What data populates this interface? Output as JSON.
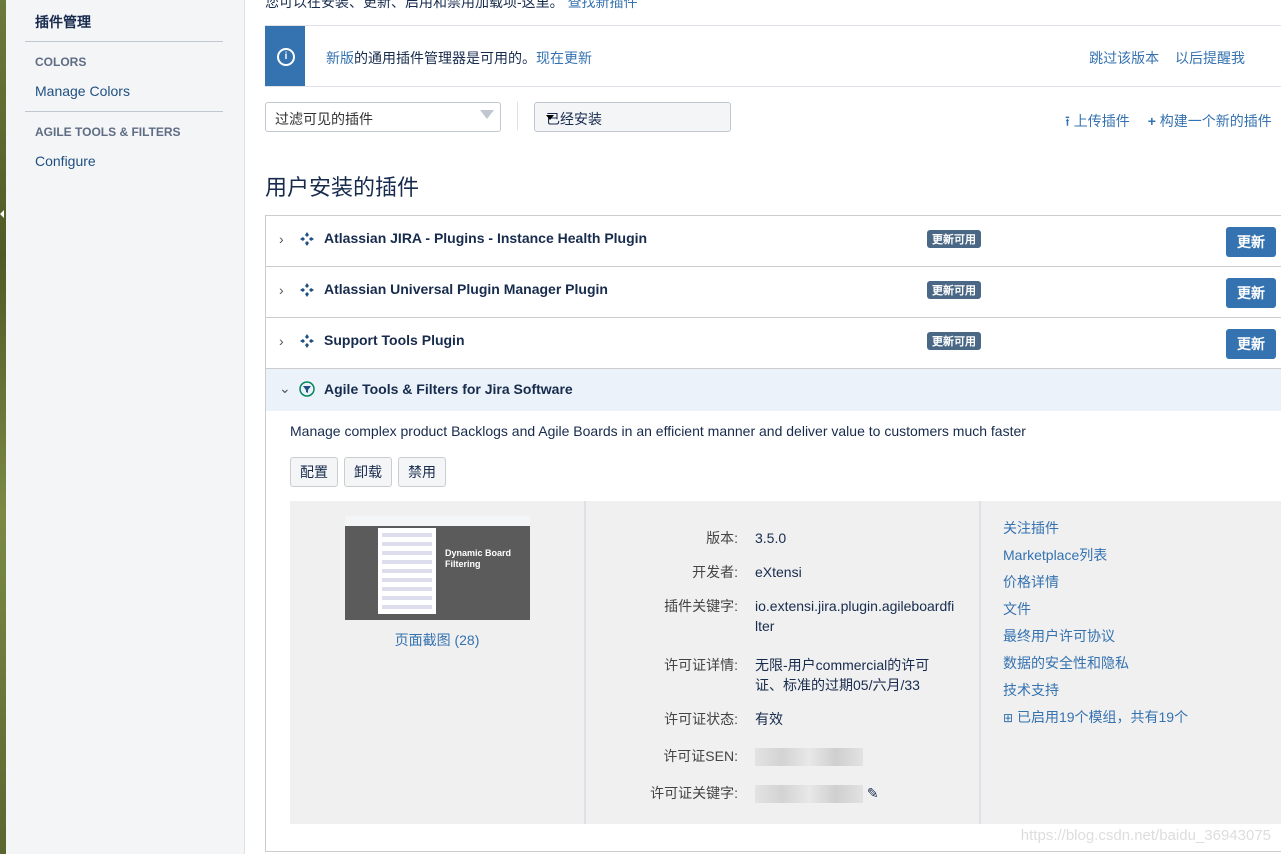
{
  "sidebar": {
    "title": "插件管理",
    "sections": [
      {
        "header": "COLORS",
        "link": "Manage Colors"
      },
      {
        "header": "AGILE TOOLS & FILTERS",
        "link": "Configure"
      }
    ]
  },
  "top_text": {
    "text": "您可以在安装、更新、启用和禁用加载项-这里。",
    "link": "查找新插件"
  },
  "banner": {
    "new_link": "新版",
    "message": "的通用插件管理器是可用的。",
    "update_link": "现在更新",
    "skip": "跳过该版本",
    "remind": "以后提醒我"
  },
  "filter": {
    "placeholder": "过滤可见的插件",
    "selected": "已经安装"
  },
  "actions": {
    "upload": "上传插件",
    "build": "构建一个新的插件"
  },
  "section_title": "用户安装的插件",
  "plugins": [
    {
      "name": "Atlassian JIRA - Plugins - Instance Health Plugin",
      "badge": "更新可用",
      "button": "更新"
    },
    {
      "name": "Atlassian Universal Plugin Manager Plugin",
      "badge": "更新可用",
      "button": "更新"
    },
    {
      "name": "Support Tools Plugin",
      "badge": "更新可用",
      "button": "更新"
    }
  ],
  "expanded": {
    "name": "Agile Tools & Filters for Jira Software",
    "description": "Manage complex product Backlogs and Agile Boards in an efficient manner and deliver value to customers much faster",
    "buttons": [
      "配置",
      "卸载",
      "禁用"
    ],
    "screenshot_label": "Dynamic Board Filtering",
    "screenshot_link": "页面截图 (28)",
    "details": [
      {
        "k": "版本:",
        "v": "3.5.0"
      },
      {
        "k": "开发者:",
        "v": "eXtensi"
      },
      {
        "k": "插件关键字:",
        "v": "io.extensi.jira.plugin.agileboardfilter"
      },
      {
        "k": "许可证详情:",
        "v": "无限-用户commercial的许可证、标准的过期05/六月/33"
      },
      {
        "k": "许可证状态:",
        "v": "有效"
      },
      {
        "k": "许可证SEN:",
        "v": ""
      },
      {
        "k": "许可证关键字:",
        "v": "AAABPA9uBA..."
      }
    ],
    "links": [
      "关注插件",
      "Marketplace列表",
      "价格详情",
      "文件",
      "最终用户许可协议",
      "数据的安全性和隐私",
      "技术支持",
      "已启用19个模组，共有19个"
    ]
  },
  "watermark": "https://blog.csdn.net/baidu_36943075"
}
